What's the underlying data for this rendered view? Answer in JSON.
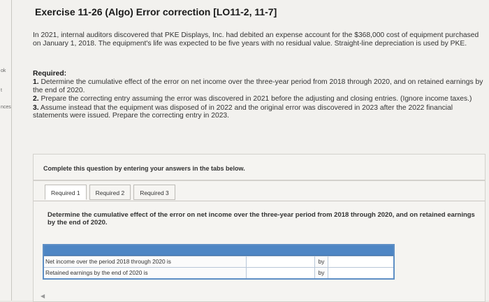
{
  "leftnav": {
    "items": [
      "ok",
      "t",
      "nces"
    ]
  },
  "exercise": {
    "title": "Exercise 11-26 (Algo) Error correction [LO11-2, 11-7]",
    "intro": "In 2021, internal auditors discovered that PKE Displays, Inc. had debited an expense account for the $368,000 cost of equipment purchased on January 1, 2018. The equipment's life was expected to be five years with no residual value. Straight-line depreciation is used by PKE.",
    "required_heading": "Required:",
    "requirements": [
      {
        "num": "1.",
        "text": "Determine the cumulative effect of the error on net income over the three-year period from 2018 through 2020, and on retained earnings by the end of 2020."
      },
      {
        "num": "2.",
        "text": "Prepare the correcting entry assuming the error was discovered in 2021 before the adjusting and closing entries. (Ignore income taxes.)"
      },
      {
        "num": "3.",
        "text": "Assume instead that the equipment was disposed of in 2022 and the original error was discovered in 2023 after the 2022 financial statements were issued. Prepare the correcting entry in 2023."
      }
    ]
  },
  "instructions": "Complete this question by entering your answers in the tabs below.",
  "tabs": [
    {
      "label": "Required 1",
      "active": true
    },
    {
      "label": "Required 2",
      "active": false
    },
    {
      "label": "Required 3",
      "active": false
    }
  ],
  "panel": {
    "description": "Determine the cumulative effect of the error on net income over the three-year period from 2018 through 2020, and on retained earnings by the end of 2020.",
    "rows": [
      {
        "label": "Net income over the period 2018 through 2020 is",
        "by": "by"
      },
      {
        "label": "Retained earnings by the end of 2020 is",
        "by": "by"
      }
    ]
  },
  "colors": {
    "grid_header": "#4e86c4",
    "grid_border": "#5e8fc5"
  }
}
